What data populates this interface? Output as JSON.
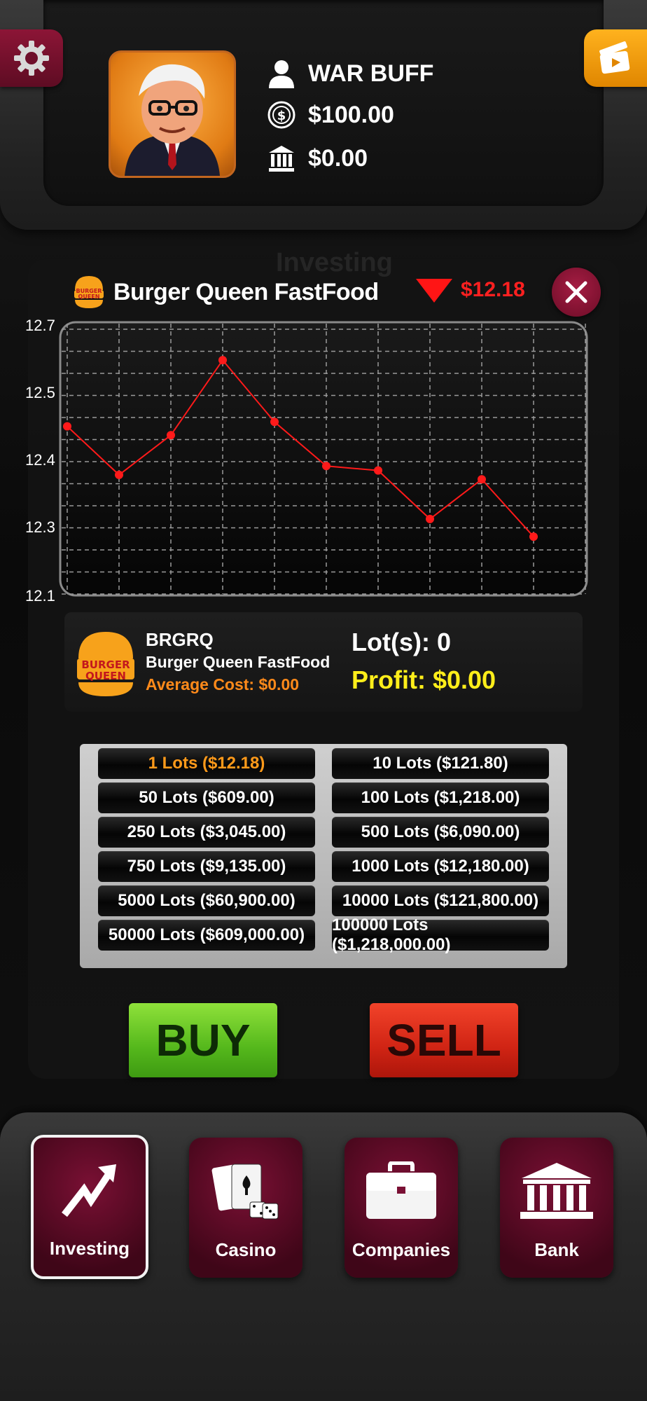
{
  "player": {
    "name": "WAR BUFF",
    "cash": "$100.00",
    "bank": "$0.00"
  },
  "background_title": "Investing",
  "stock": {
    "logo_text": [
      "BURGER",
      "QUEEN"
    ],
    "name": "Burger Queen FastFood",
    "ticker": "BRGRQ",
    "price": "$12.18",
    "trend": "down",
    "average_cost": "Average Cost: $0.00",
    "lots": "Lot(s): 0",
    "profit": "Profit: $0.00"
  },
  "chart_data": {
    "type": "line",
    "x": [
      1,
      2,
      3,
      4,
      5,
      6,
      7,
      8,
      9,
      10,
      11
    ],
    "series": [
      {
        "values": [
          12.48,
          12.37,
          12.46,
          12.63,
          12.49,
          12.39,
          12.38,
          12.27,
          12.36,
          12.23
        ]
      }
    ],
    "y_tick_labels": [
      "12.7",
      "12.5",
      "12.4",
      "12.3",
      "12.1"
    ],
    "ylim": [
      12.1,
      12.7
    ],
    "grid": true,
    "line_color": "#ff1a1a"
  },
  "lot_options": [
    "1 Lots ($12.18)",
    "10 Lots ($121.80)",
    "50 Lots ($609.00)",
    "100 Lots ($1,218.00)",
    "250 Lots ($3,045.00)",
    "500 Lots ($6,090.00)",
    "750 Lots ($9,135.00)",
    "1000 Lots ($12,180.00)",
    "5000 Lots ($60,900.00)",
    "10000 Lots ($121,800.00)",
    "50000 Lots ($609,000.00)",
    "100000 Lots ($1,218,000.00)"
  ],
  "selected_lot_index": 0,
  "actions": {
    "buy": "BUY",
    "sell": "SELL"
  },
  "nav": [
    {
      "label": "Investing",
      "icon": "trend-up-arrow-icon",
      "active": true
    },
    {
      "label": "Casino",
      "icon": "playing-cards-dice-icon",
      "active": false
    },
    {
      "label": "Companies",
      "icon": "briefcase-icon",
      "active": false
    },
    {
      "label": "Bank",
      "icon": "bank-building-icon",
      "active": false
    }
  ],
  "colors": {
    "accent_maroon": "#7a1034",
    "negative": "#ff2020",
    "profit": "#ffee1a",
    "avg_cost": "#ff8a1a",
    "buy": "#55b81c",
    "sell": "#d02414"
  }
}
